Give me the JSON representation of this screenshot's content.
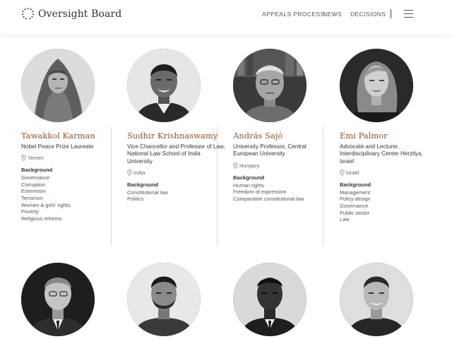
{
  "header": {
    "logo_text": "Oversight Board",
    "logo_icon": "oversight-logo-icon",
    "nav": [
      "APPEALS PROCESS",
      "NEWS",
      "DECISIONS"
    ],
    "menu_icon": "hamburger-menu-icon"
  },
  "members": [
    {
      "name": "Tawakkol Karman",
      "role": "Nobel Peace Prize Laureate",
      "location": "Yemen",
      "background_heading": "Background",
      "background": [
        "Governance",
        "Corruption",
        "Extremism",
        "Terrorism",
        "Women & girls' rights",
        "Poverty",
        "Religious reforms"
      ]
    },
    {
      "name": "Sudhir Krishnaswamy",
      "role": "Vice Chancellor and Professor of Law, National Law School of India University",
      "location": "India",
      "background_heading": "Background",
      "background": [
        "Constitutional law",
        "Politics"
      ]
    },
    {
      "name": "András Sajó",
      "role": "University Professor, Central European University",
      "location": "Hungary",
      "background_heading": "Background",
      "background": [
        "Human rights",
        "Freedom of expression",
        "Comparative constitutional law"
      ]
    },
    {
      "name": "Emi Palmor",
      "role": "Advocate and Lecturer, Interdisciplinary Center Herzliya, Israel",
      "location": "Israel",
      "background_heading": "Background",
      "background": [
        "Management",
        "Policy design",
        "Governance",
        "Public sector",
        "Law"
      ]
    }
  ]
}
